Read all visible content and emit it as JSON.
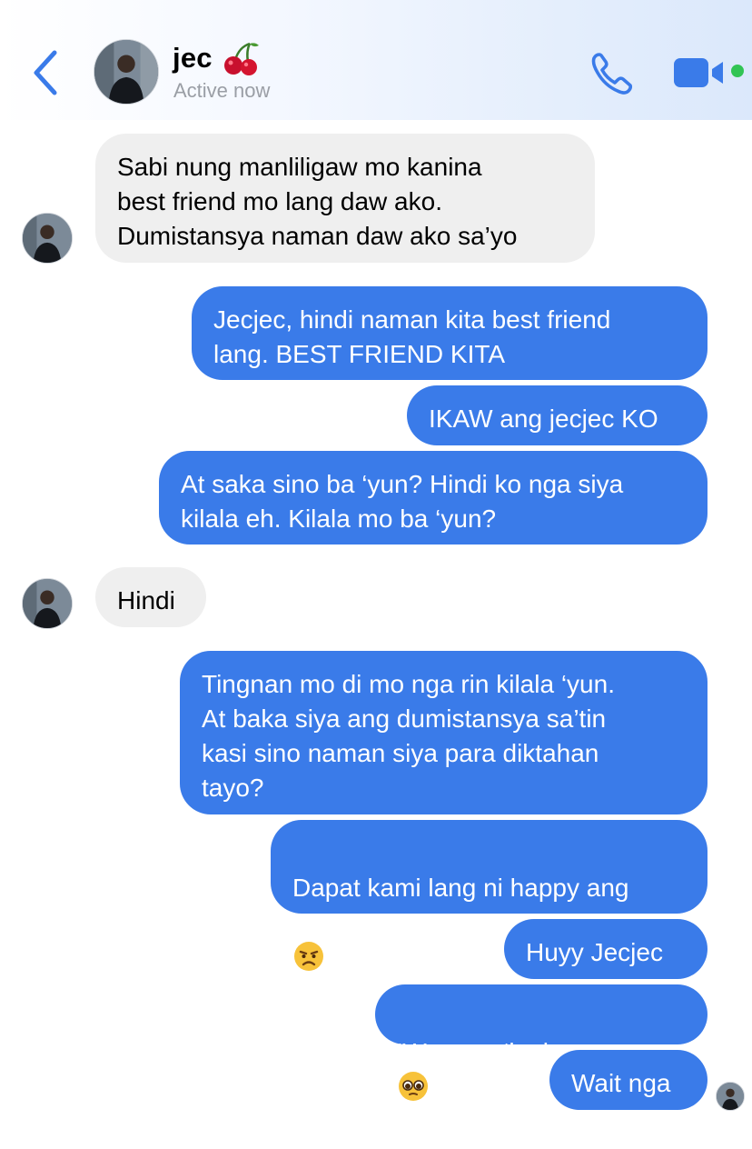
{
  "header": {
    "contact_name": "jec",
    "contact_emoji": "cherries-icon",
    "status": "Active now",
    "icons": [
      "back-chevron-icon",
      "phone-icon",
      "video-camera-icon"
    ],
    "accent_color": "#3a7be9"
  },
  "messages": [
    {
      "from": "contact",
      "text": "Sabi nung manliligaw mo kanina\nbest friend mo lang daw ako.\nDumistansya naman daw ako sa’yo"
    },
    {
      "from": "me",
      "text": "Jecjec, hindi naman kita best friend\nlang. BEST FRIEND KITA"
    },
    {
      "from": "me",
      "text": "IKAW ang jecjec KO"
    },
    {
      "from": "me",
      "text": "At saka sino ba ‘yun? Hindi ko nga siya\nkilala eh. Kilala mo ba ‘yun?"
    },
    {
      "from": "contact",
      "text": "Hindi"
    },
    {
      "from": "me",
      "text": "Tingnan mo di mo nga rin kilala ‘yun.\nAt baka siya ang dumistansya sa’tin\nkasi sino naman siya para diktahan\ntayo?"
    },
    {
      "from": "me",
      "text": "Dapat kami lang ni happy ang\naaway sa’yo",
      "emoji": "angry-face-icon"
    },
    {
      "from": "me",
      "text": "Huyy Jecjec"
    },
    {
      "from": "me",
      "text": "‘Wag mo ‘ko iseen",
      "emoji": "pleading-face-icon"
    },
    {
      "from": "me",
      "text": "Wait nga"
    }
  ],
  "colors": {
    "outgoing_bubble": "#3a7be9",
    "incoming_bubble": "#efefef",
    "online_dot": "#31c454"
  }
}
